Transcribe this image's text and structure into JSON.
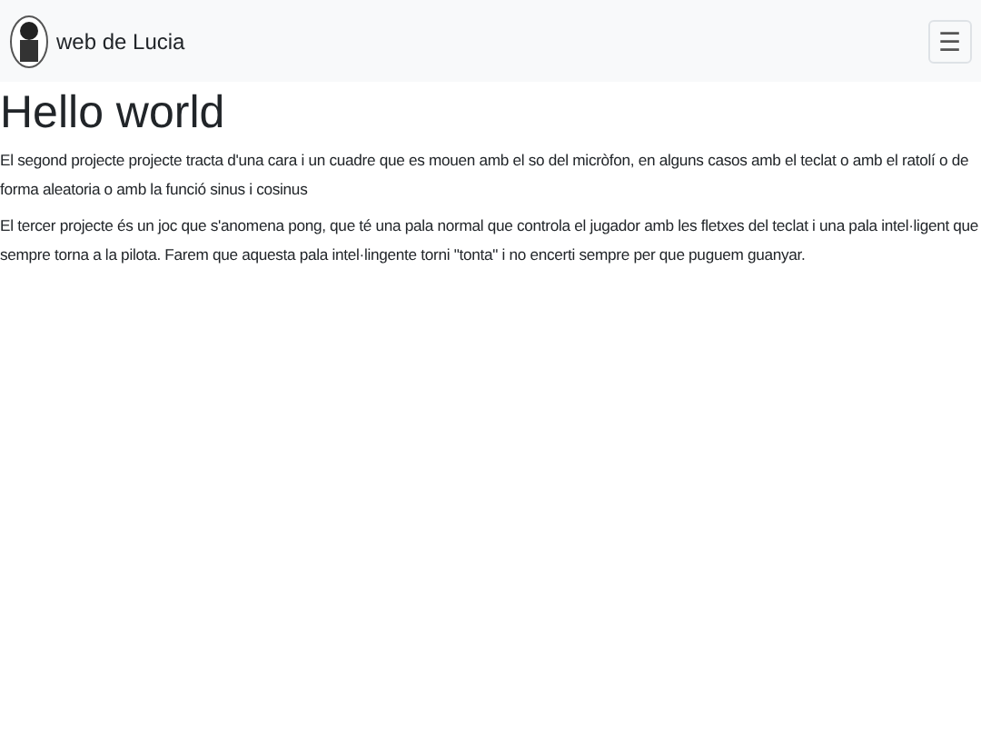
{
  "navbar": {
    "brand": "web de Lucia",
    "toggler": "☰"
  },
  "heading": "Hello world",
  "paragraphs": [
    "El segond projecte projecte tracta d'una cara i un cuadre que es mouen amb el so del micròfon, en alguns casos amb el teclat o amb el ratolí o de forma aleatoria o amb la funció sinus i cosinus",
    "El tercer projecte és un joc que s'anomena pong, que té una pala normal que controla el jugador amb les fletxes del teclat i una pala intel·ligent que sempre torna a la pilota. Farem que aquesta pala intel·lingente torni \"tonta\" i no encerti sempre per que puguem guanyar."
  ]
}
